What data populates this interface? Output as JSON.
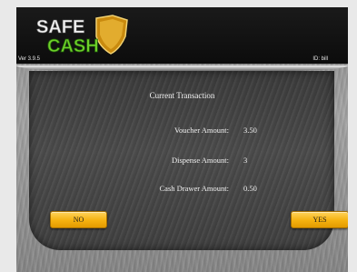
{
  "header": {
    "logo_top": "SAFE",
    "logo_bottom": "CASH",
    "version": "Ver 3.9.5",
    "user_id": "ID: bill"
  },
  "transaction": {
    "title": "Current Transaction",
    "rows": [
      {
        "label": "Voucher Amount:",
        "value": "3.50"
      },
      {
        "label": "Dispense Amount:",
        "value": "3"
      },
      {
        "label": "Cash Drawer Amount:",
        "value": "0.50"
      }
    ]
  },
  "buttons": {
    "no": "NO",
    "yes": "YES"
  },
  "colors": {
    "button_gold": "#f5b10f",
    "logo_gold": "#e0a41a",
    "panel_dark": "#3f3f3f"
  }
}
